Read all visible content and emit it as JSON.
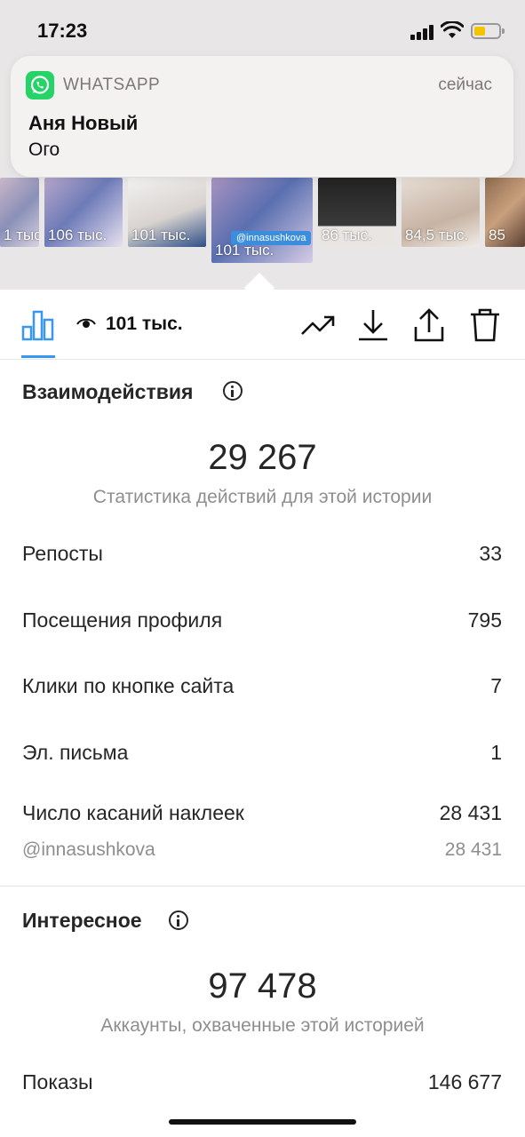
{
  "status_bar": {
    "time": "17:23",
    "battery_color": "#f4c400"
  },
  "notification": {
    "app": "WHATSAPP",
    "time": "сейчас",
    "title": "Аня Новый",
    "body": "Ого",
    "app_icon": "whatsapp-icon",
    "accent": "#25d366"
  },
  "thumbnails": [
    {
      "count": "1 тыс."
    },
    {
      "count": "106 тыс."
    },
    {
      "count": "101 тыс."
    },
    {
      "count": "101 тыс.",
      "selected": true,
      "tag": "@innasushkova"
    },
    {
      "count": "86 тыс."
    },
    {
      "count": "84,5 тыс."
    },
    {
      "count": "85"
    }
  ],
  "toolbar": {
    "views": "101 тыс.",
    "icons": [
      "bar-chart-icon",
      "eye-icon",
      "trend-icon",
      "download-icon",
      "share-icon",
      "trash-icon"
    ],
    "accent": "#3897f0"
  },
  "interactions": {
    "title": "Взаимодействия",
    "total": "29 267",
    "subtitle": "Статистика действий для этой истории",
    "rows": [
      {
        "label": "Репосты",
        "value": "33"
      },
      {
        "label": "Посещения профиля",
        "value": "795"
      },
      {
        "label": "Клики по кнопке сайта",
        "value": "7"
      },
      {
        "label": "Эл. письма",
        "value": "1"
      },
      {
        "label": "Число касаний наклеек",
        "value": "28 431"
      }
    ],
    "sub_row": {
      "label": "@innasushkova",
      "value": "28 431"
    }
  },
  "discovery": {
    "title": "Интересное",
    "total": "97 478",
    "subtitle": "Аккаунты, охваченные этой историей",
    "rows": [
      {
        "label": "Показы",
        "value": "146 677"
      }
    ]
  }
}
